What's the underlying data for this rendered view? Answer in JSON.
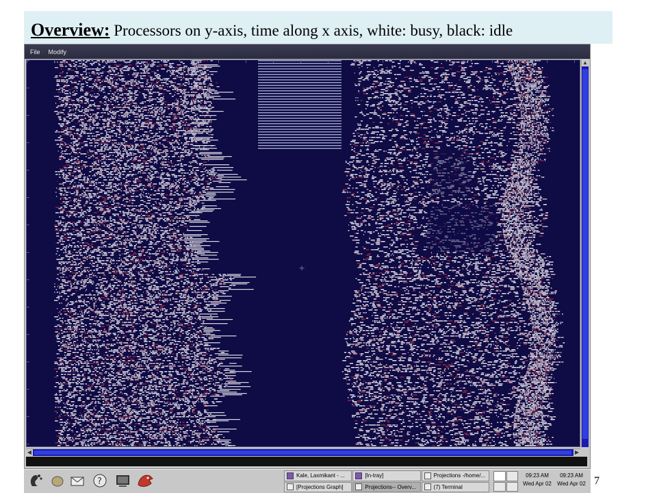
{
  "slide": {
    "title_lead": "Overview:",
    "title_rest": " Processors on y-axis, time along x axis, white: busy, black: idle",
    "page_number": "7"
  },
  "app": {
    "menu": [
      "File",
      "Modify"
    ]
  },
  "colors": {
    "idle": "#0f0b45",
    "busy": "#ffffff",
    "busy_alt": "#f4c8d0",
    "overhead": "#9a2f45"
  },
  "taskbar": {
    "launchers": [
      "gnome-foot-icon",
      "egg-icon",
      "mail-icon",
      "help-icon",
      "terminal-icon",
      "ximian-logo-icon"
    ],
    "tasks": [
      {
        "label": "Kale, Laxmikant - ...",
        "icon": "purple",
        "active": false
      },
      {
        "label": "[In-tray]",
        "icon": "purple",
        "active": false
      },
      {
        "label": "Projections -/home/...",
        "icon": "window",
        "active": false
      },
      {
        "label": "[Projections Graph]",
        "icon": "window",
        "active": false
      },
      {
        "label": "Projections-- Overv...",
        "icon": "window",
        "active": true
      },
      {
        "label": "(7) Terminal",
        "icon": "window",
        "active": false
      }
    ],
    "clock_left": {
      "time": "09:23 AM",
      "date": "Wed Apr 02"
    },
    "clock_right": {
      "time": "09:23 AM",
      "date": "Wed Apr 02"
    }
  }
}
